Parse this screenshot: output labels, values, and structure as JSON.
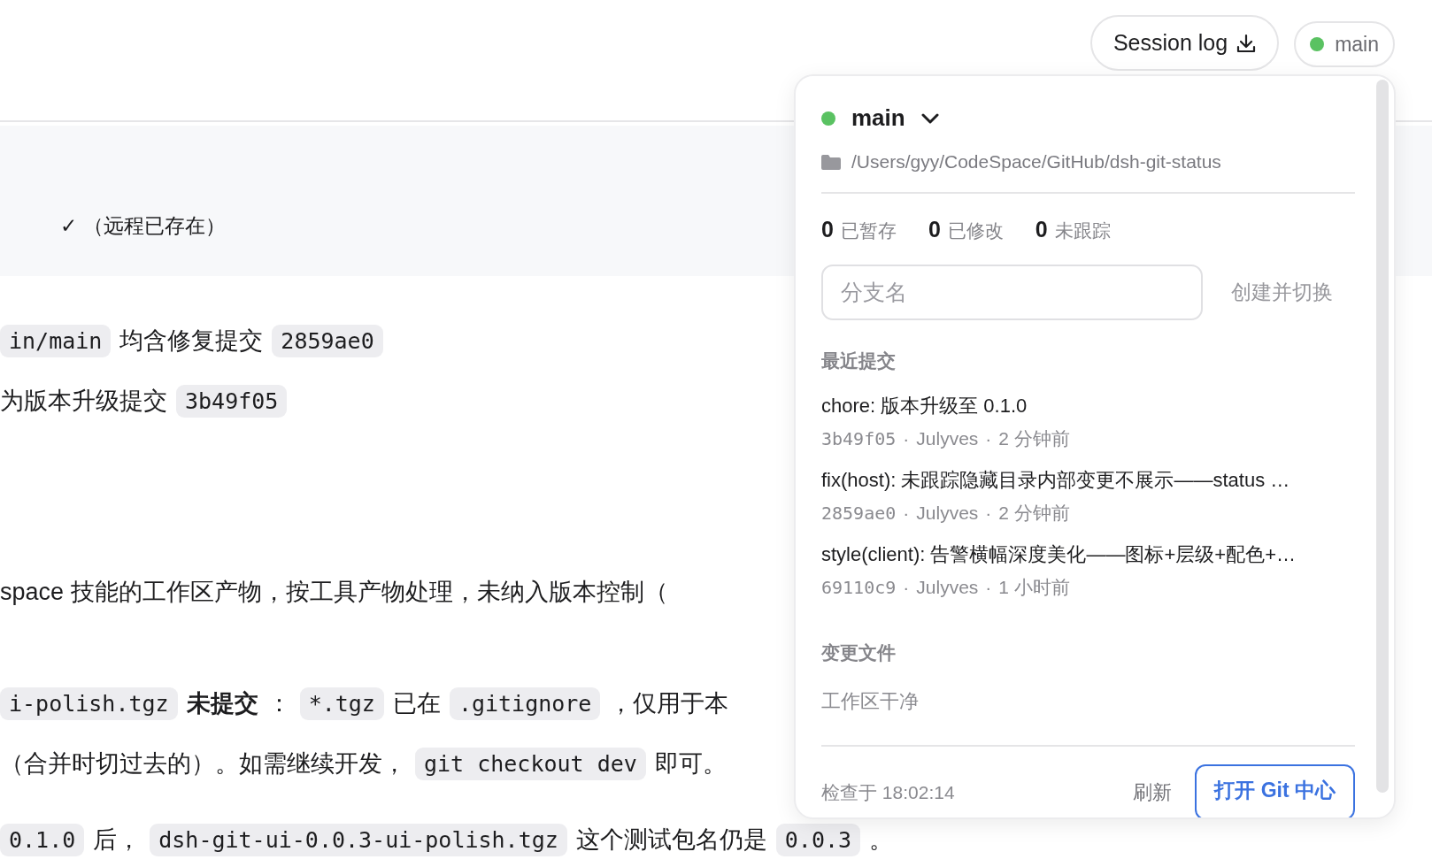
{
  "header": {
    "session_log_button": "Session log",
    "branch_badge": {
      "label": "main",
      "color": "#5ac262"
    }
  },
  "document": {
    "code_block": [
      "✓ （远程已存在）"
    ],
    "paragraphs": [
      [
        [
          {
            "kind": "code",
            "text": "in/main"
          },
          {
            "kind": "text",
            "text": "均含修复提交"
          },
          {
            "kind": "code",
            "text": "2859ae0"
          }
        ],
        [
          {
            "kind": "text",
            "text": "为版本升级提交"
          },
          {
            "kind": "code",
            "text": "3b49f05"
          }
        ]
      ],
      [
        [
          {
            "kind": "text",
            "text": "space 技能的工作区产物，按工具产物处理，未纳入版本控制（"
          }
        ]
      ],
      [
        [
          {
            "kind": "code",
            "text": "i-polish.tgz"
          },
          {
            "kind": "bold",
            "text": "未提交"
          },
          {
            "kind": "text",
            "text": "："
          },
          {
            "kind": "code",
            "text": "*.tgz"
          },
          {
            "kind": "text",
            "text": "已在"
          },
          {
            "kind": "code",
            "text": ".gitignore"
          },
          {
            "kind": "text",
            "text": "，仅用于本"
          }
        ],
        [
          {
            "kind": "text",
            "text": "（合并时切过去的）。如需继续开发，"
          },
          {
            "kind": "code",
            "text": "git checkout dev"
          },
          {
            "kind": "text",
            "text": "即可。"
          }
        ]
      ],
      [
        [
          {
            "kind": "code",
            "text": "0.1.0"
          },
          {
            "kind": "text",
            "text": "后，"
          },
          {
            "kind": "code",
            "text": "dsh-git-ui-0.0.3-ui-polish.tgz"
          },
          {
            "kind": "text",
            "text": "这个测试包名仍是"
          },
          {
            "kind": "code",
            "text": "0.0.3"
          },
          {
            "kind": "text",
            "text": "。"
          }
        ]
      ]
    ]
  },
  "popover": {
    "branch": {
      "name": "main",
      "color": "#5ac262"
    },
    "path": "/Users/gyy/CodeSpace/GitHub/dsh-git-status",
    "counts": [
      {
        "count": "0",
        "label": "已暂存"
      },
      {
        "count": "0",
        "label": "已修改"
      },
      {
        "count": "0",
        "label": "未跟踪"
      }
    ],
    "branch_field": {
      "placeholder": "分支名"
    },
    "create_button": "创建并切换",
    "recent_title": "最近提交",
    "commits": [
      {
        "message": "chore: 版本升级至 0.1.0",
        "hash": "3b49f05",
        "separator": "·",
        "author": "Julyves",
        "time": "2 分钟前"
      },
      {
        "message": "fix(host): 未跟踪隐藏目录内部变更不展示——status …",
        "hash": "2859ae0",
        "separator": "·",
        "author": "Julyves",
        "time": "2 分钟前"
      },
      {
        "message": "style(client): 告警横幅深度美化——图标+层级+配色+…",
        "hash": "69110c9",
        "separator": "·",
        "author": "Julyves",
        "time": "1 小时前"
      }
    ],
    "changes_title": "变更文件",
    "changes_empty": "工作区干净",
    "footer": {
      "checked": "检查于 18:02:14",
      "refresh_button": "刷新",
      "open_button": "打开 Git 中心"
    }
  }
}
